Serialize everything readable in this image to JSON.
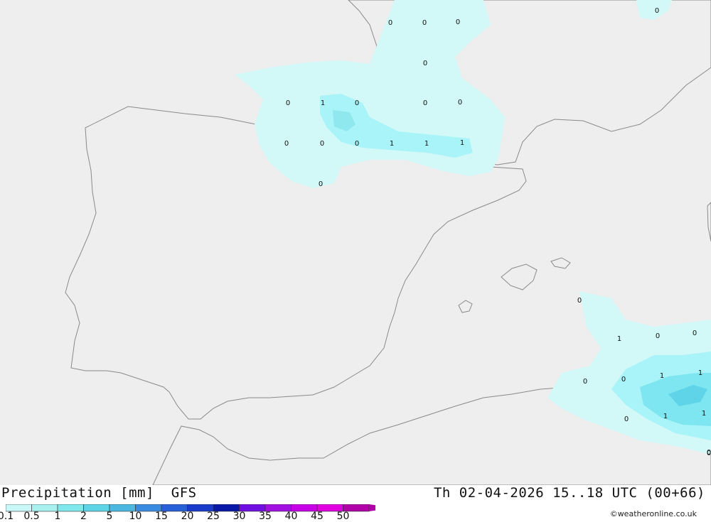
{
  "header": {
    "title": "Precipitation [mm]  GFS",
    "datetime": "Th 02-04-2026 15..18 UTC (00+66)",
    "credit": "©weatheronline.co.uk"
  },
  "legend": {
    "ticks": [
      "0.1",
      "0.5",
      "1",
      "2",
      "5",
      "10",
      "15",
      "20",
      "25",
      "30",
      "35",
      "40",
      "45",
      "50"
    ],
    "colors": [
      "#c8f8f8",
      "#a8f0f0",
      "#7ee8ec",
      "#5cd4e6",
      "#4ab8e0",
      "#3a8ce0",
      "#2860d8",
      "#1a3cc8",
      "#0a18a8",
      "#7010e0",
      "#a010e0",
      "#c800e8",
      "#e000e0",
      "#b000a8"
    ]
  },
  "colors": {
    "sea": "#eeeeee",
    "land": "#c8f6a8",
    "precip_light": "#d2f8f8",
    "precip_medium": "#a8f4f8",
    "precip_heavy": "#7ee6f0"
  },
  "map_values": [
    "0",
    "0",
    "0",
    "0",
    "0",
    "0",
    "1",
    "0",
    "0",
    "0",
    "0",
    "0",
    "0",
    "1",
    "1",
    "1",
    "0",
    "0",
    "0",
    "1",
    "0",
    "0",
    "0",
    "0",
    "1",
    "1",
    "0",
    "1",
    "1",
    "0"
  ]
}
